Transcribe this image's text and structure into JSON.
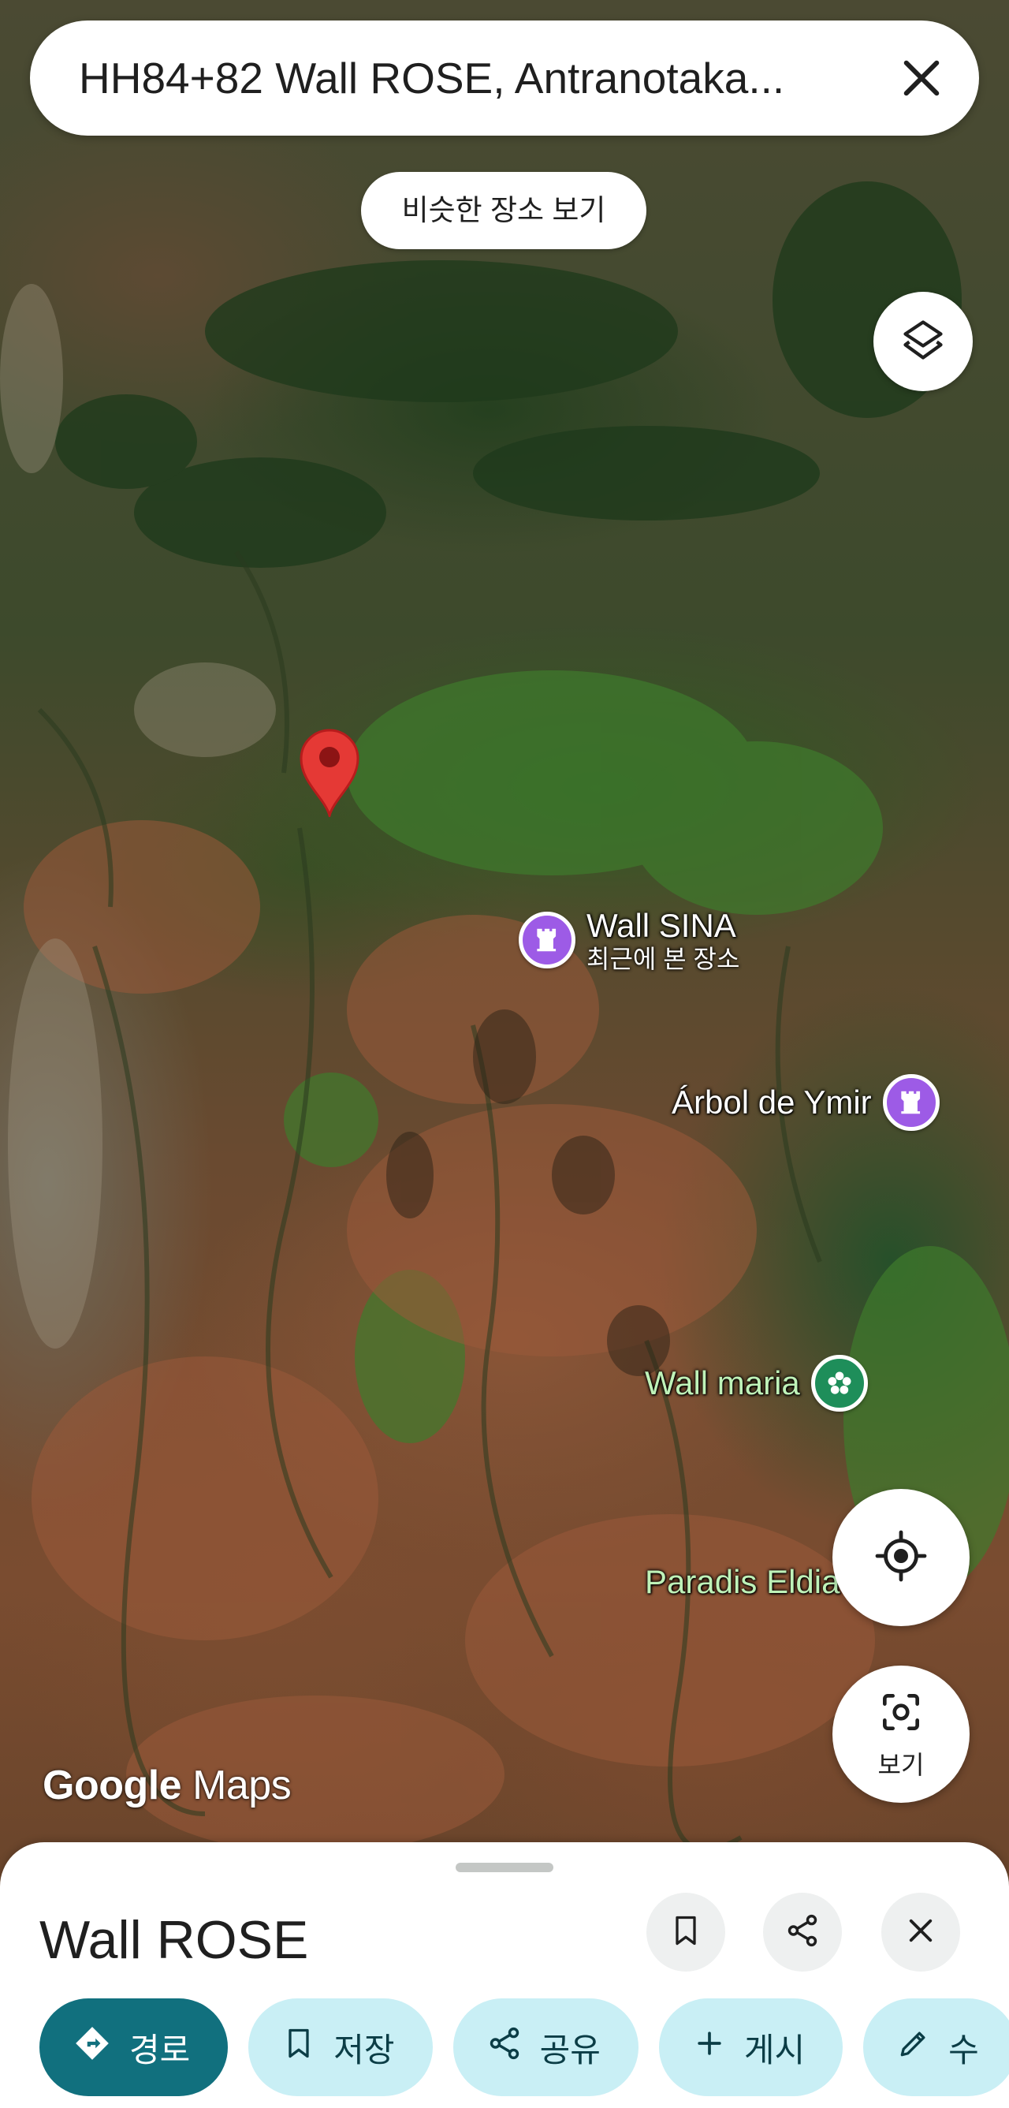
{
  "search": {
    "query": "HH84+82 Wall ROSE, Antranotaka..."
  },
  "chips": {
    "similar_places": "비슷한 장소 보기"
  },
  "map": {
    "pois": [
      {
        "name": "Wall SINA",
        "subtitle": "최근에 본 장소",
        "icon": "castle-icon",
        "color": "#9d5be6"
      },
      {
        "name": "Árbol de Ymir",
        "icon": "castle-icon",
        "color": "#9d5be6"
      },
      {
        "name": "Wall maria",
        "icon": "flower-icon",
        "color": "#1e8e5a"
      },
      {
        "name": "Paradis Eldia"
      }
    ],
    "pin": {
      "icon": "location-pin-icon",
      "color": "#e53935"
    }
  },
  "controls": {
    "lens_label": "보기"
  },
  "logo": {
    "google": "Google",
    "maps": "Maps"
  },
  "sheet": {
    "title": "Wall ROSE",
    "actions": [
      {
        "label": "경로",
        "icon": "directions-icon"
      },
      {
        "label": "저장",
        "icon": "bookmark-icon"
      },
      {
        "label": "공유",
        "icon": "share-icon"
      },
      {
        "label": "게시",
        "icon": "plus-icon"
      },
      {
        "label": "수",
        "icon": "pencil-icon"
      }
    ]
  },
  "colors": {
    "primary": "#11707e",
    "tonal": "#c9eff5",
    "pin": "#e53935",
    "poi_purple": "#9d5be6",
    "poi_green": "#1e8e5a"
  }
}
